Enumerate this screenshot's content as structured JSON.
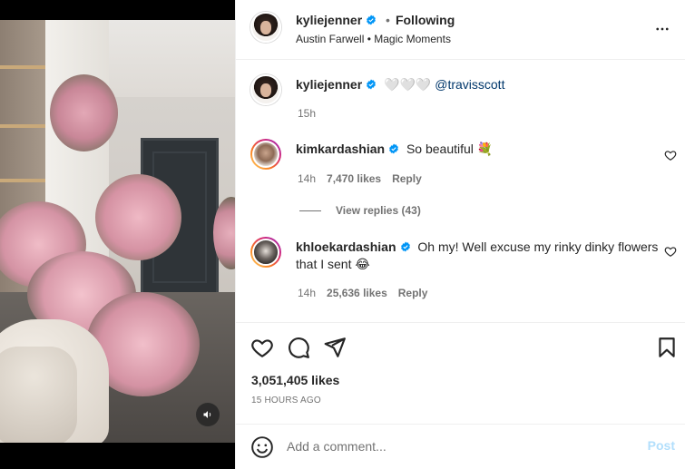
{
  "post": {
    "author": "kyliejenner",
    "separator": "•",
    "follow_status": "Following",
    "audio_artist": "Austin Farwell",
    "audio_dot": "•",
    "audio_title": "Magic Moments"
  },
  "caption": {
    "username": "kyliejenner",
    "text": "🤍🤍🤍",
    "mention": "@travisscott",
    "time": "15h"
  },
  "comments": [
    {
      "username": "kimkardashian",
      "text": "So beautiful 💐",
      "time": "14h",
      "likes": "7,470 likes",
      "reply_label": "Reply"
    },
    {
      "username": "khloekardashian",
      "text": "Oh my! Well excuse my rinky dinky flowers that I sent 😂",
      "time": "14h",
      "likes": "25,636 likes",
      "reply_label": "Reply"
    }
  ],
  "view_replies": "View replies (43)",
  "likes_count": "3,051,405 likes",
  "posted_ago": "15 HOURS AGO",
  "add_comment": {
    "placeholder": "Add a comment...",
    "post_label": "Post"
  },
  "icons": {
    "more": "more-horizontal-icon",
    "verified": "verified-badge-icon",
    "heart": "heart-outline-icon",
    "comment": "comment-bubble-icon",
    "share": "paper-plane-icon",
    "save": "bookmark-icon",
    "emoji": "smiley-icon",
    "sound": "speaker-icon"
  },
  "colors": {
    "verified_blue": "#0095f6",
    "post_disabled": "#b2dffc",
    "link": "#00376b",
    "muted": "#737373"
  }
}
